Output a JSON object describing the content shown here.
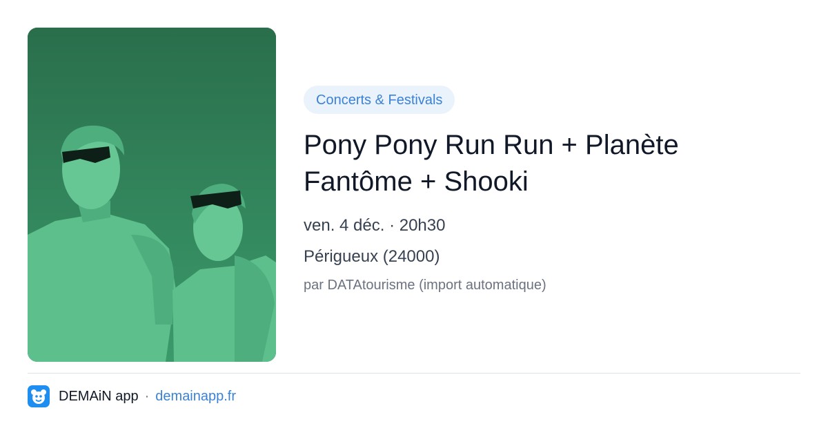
{
  "event": {
    "category": "Concerts & Festivals",
    "title": "Pony Pony Run Run + Planète Fantôme + Shooki",
    "datetime": "ven. 4 déc. · 20h30",
    "location": "Périgueux (24000)",
    "author": "par DATAtourisme (import automatique)",
    "image_icon": "band-photo",
    "image_tint": "#3a9b6c"
  },
  "footer": {
    "app_name": "DEMAiN app",
    "separator": "·",
    "domain": "demainapp.fr",
    "logo_icon": "demain-app-logo-icon"
  },
  "colors": {
    "accent": "#3b82d6",
    "pill_bg": "#eaf2fb",
    "text": "#111827",
    "muted": "#6b7280"
  }
}
